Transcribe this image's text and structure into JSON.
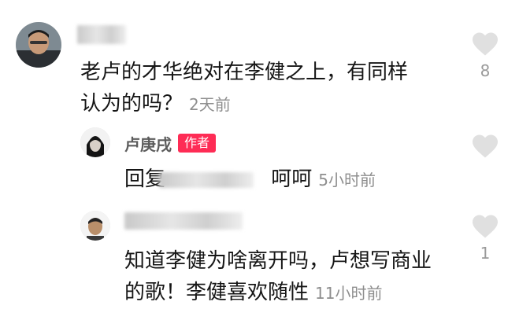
{
  "comments": [
    {
      "text_line1": "老卢的才华绝对在李健之上，有同样",
      "text_line2": "认为的吗？",
      "time": "2天前",
      "likes": "8",
      "like_icon": "heart-icon"
    }
  ],
  "replies": [
    {
      "nickname": "卢庚戌",
      "badge": "作者",
      "prefix": "回复",
      "text": "呵呵",
      "time": "5小时前",
      "like_icon": "heart-icon"
    },
    {
      "text_line1": "知道李健为啥离开吗，卢想写商业",
      "text_line2": "的歌！李健喜欢随性",
      "time": "11小时前",
      "likes": "1",
      "like_icon": "heart-icon"
    }
  ],
  "colors": {
    "badge": "#fe2c55",
    "heart": "#e0e0e0",
    "text": "#161616",
    "meta": "#8e8e8e"
  }
}
